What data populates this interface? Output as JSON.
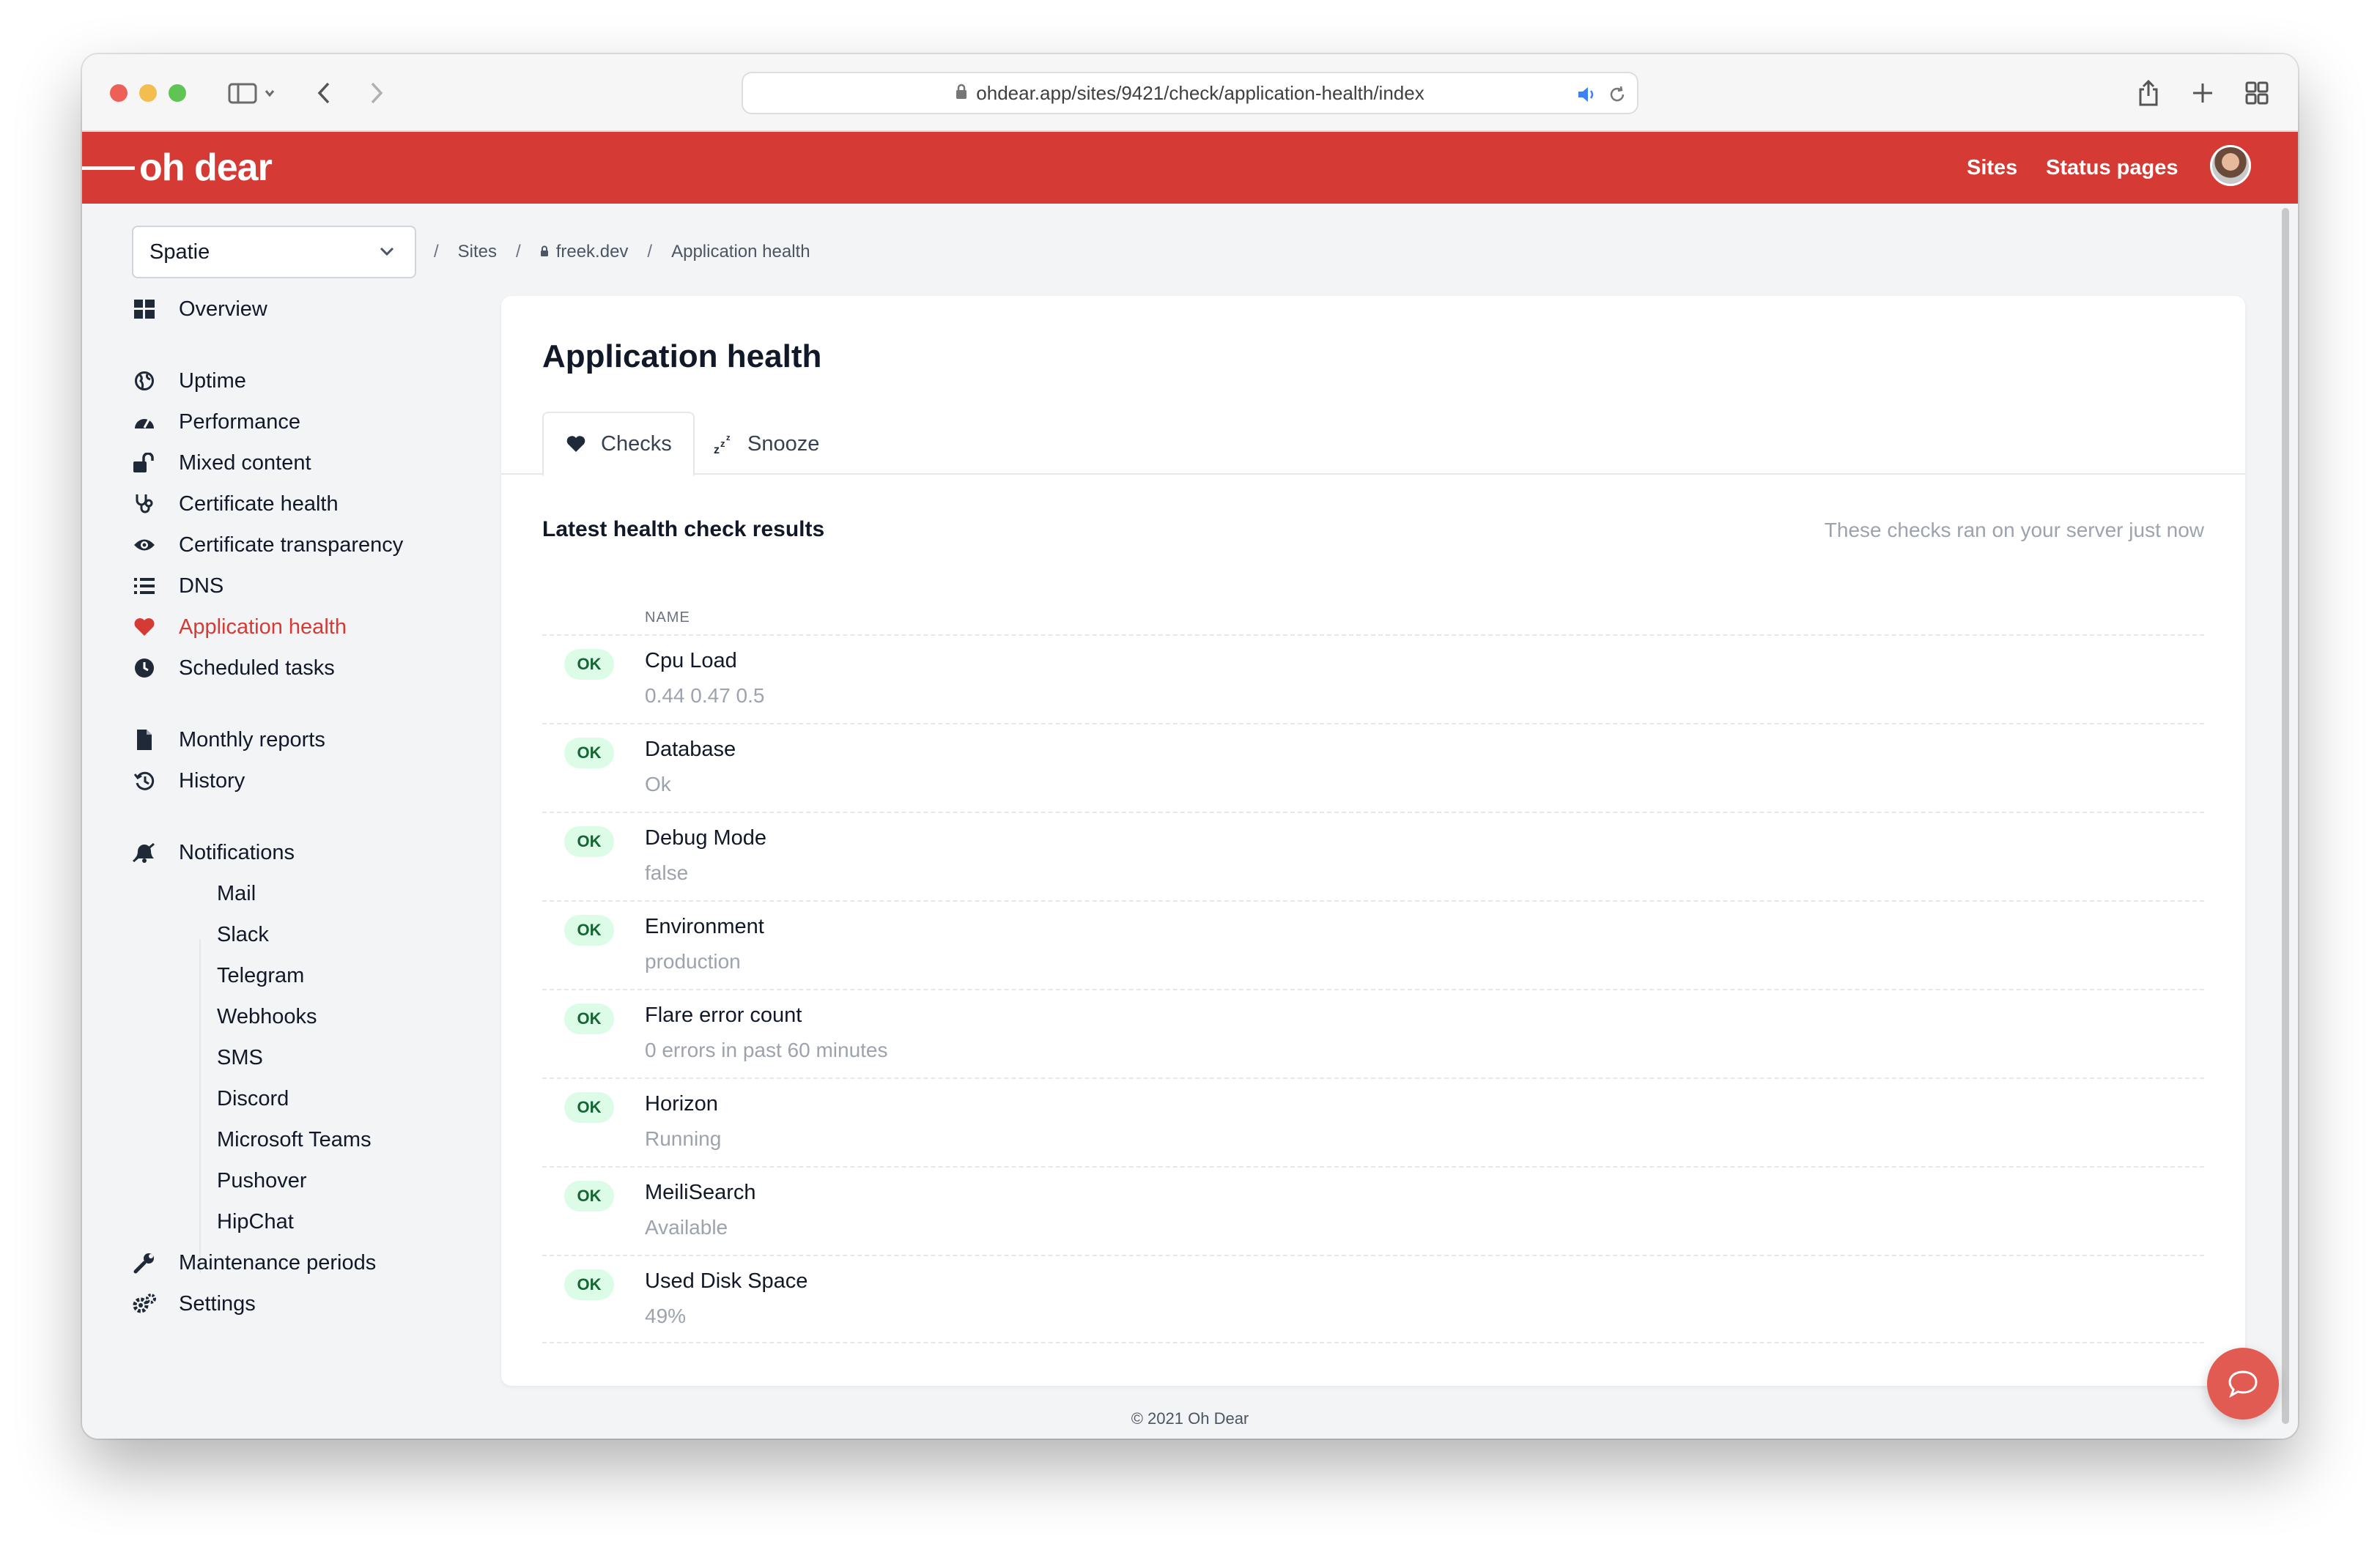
{
  "browser": {
    "url": "ohdear.app/sites/9421/check/application-health/index"
  },
  "header": {
    "logo": "oh dear",
    "nav": [
      "Sites",
      "Status pages"
    ]
  },
  "team_select": {
    "value": "Spatie"
  },
  "breadcrumb": {
    "items": [
      "Sites",
      "freek.dev",
      "Application health"
    ]
  },
  "sidebar": {
    "overview": "Overview",
    "checks": [
      {
        "label": "Uptime",
        "icon": "globe-icon"
      },
      {
        "label": "Performance",
        "icon": "gauge-icon"
      },
      {
        "label": "Mixed content",
        "icon": "unlock-icon"
      },
      {
        "label": "Certificate health",
        "icon": "stethoscope-icon"
      },
      {
        "label": "Certificate transparency",
        "icon": "eye-icon"
      },
      {
        "label": "DNS",
        "icon": "list-icon"
      },
      {
        "label": "Application health",
        "icon": "heart-icon"
      },
      {
        "label": "Scheduled tasks",
        "icon": "clock-icon"
      }
    ],
    "monthly_reports": "Monthly reports",
    "history": "History",
    "notifications": "Notifications",
    "notification_channels": [
      "Mail",
      "Slack",
      "Telegram",
      "Webhooks",
      "SMS",
      "Discord",
      "Microsoft Teams",
      "Pushover",
      "HipChat"
    ],
    "maintenance": "Maintenance periods",
    "settings": "Settings"
  },
  "page": {
    "title": "Application health",
    "tabs": [
      "Checks",
      "Snooze"
    ],
    "section_title": "Latest health check results",
    "section_note": "These checks ran on your server just now",
    "column_name": "NAME",
    "results": [
      {
        "status": "OK",
        "name": "Cpu Load",
        "value": "0.44 0.47 0.5"
      },
      {
        "status": "OK",
        "name": "Database",
        "value": "Ok"
      },
      {
        "status": "OK",
        "name": "Debug Mode",
        "value": "false"
      },
      {
        "status": "OK",
        "name": "Environment",
        "value": "production"
      },
      {
        "status": "OK",
        "name": "Flare error count",
        "value": "0 errors in past 60 minutes"
      },
      {
        "status": "OK",
        "name": "Horizon",
        "value": "Running"
      },
      {
        "status": "OK",
        "name": "MeiliSearch",
        "value": "Available"
      },
      {
        "status": "OK",
        "name": "Used Disk Space",
        "value": "49%"
      }
    ]
  },
  "footer": {
    "text": "© 2021 Oh Dear"
  },
  "colors": {
    "brand": "#d63a34",
    "ok_badge_bg": "#dcfce7",
    "ok_badge_text": "#166534"
  }
}
